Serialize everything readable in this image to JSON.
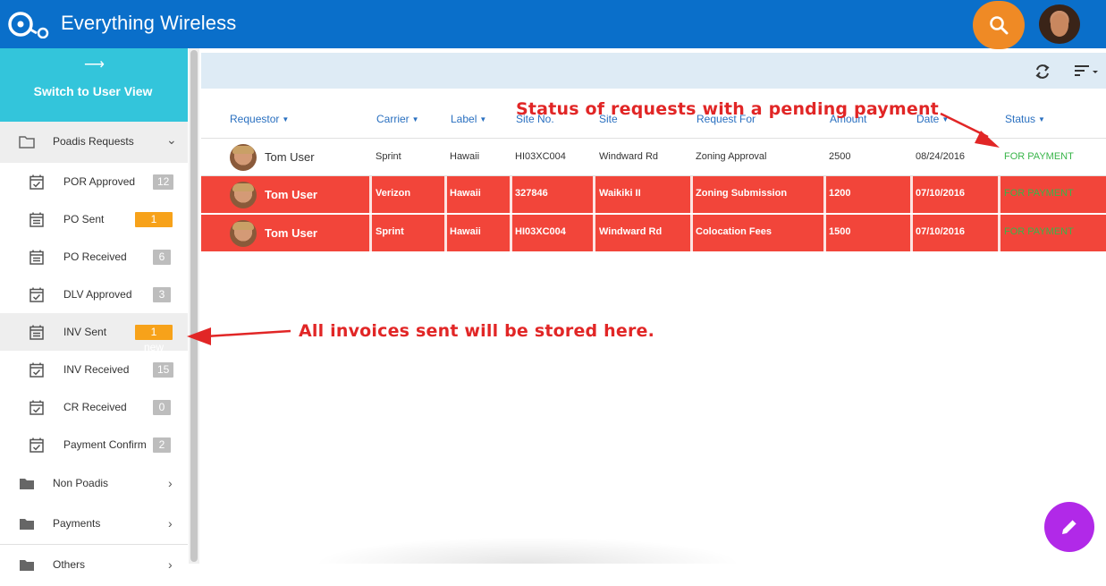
{
  "app": {
    "title": "Everything Wireless"
  },
  "sidebar": {
    "switch_label": "Switch to User View",
    "open_section": "Poadis Requests",
    "items": [
      {
        "label": "POR Approved",
        "badge": "12",
        "badge_type": "grey",
        "icon": "calendar-check-icon"
      },
      {
        "label": "PO Sent",
        "badge": "1 new",
        "badge_type": "orange",
        "icon": "calendar-list-icon"
      },
      {
        "label": "PO Received",
        "badge": "6",
        "badge_type": "grey",
        "icon": "calendar-list-icon"
      },
      {
        "label": "DLV Approved",
        "badge": "3",
        "badge_type": "grey",
        "icon": "calendar-check-icon"
      },
      {
        "label": "INV Sent",
        "badge": "1 new",
        "badge_type": "orange",
        "icon": "calendar-list-icon"
      },
      {
        "label": "INV Received",
        "badge": "15",
        "badge_type": "grey",
        "icon": "calendar-check-icon"
      },
      {
        "label": "CR Received",
        "badge": "0",
        "badge_type": "grey",
        "icon": "calendar-check-icon"
      },
      {
        "label": "Payment Confirm",
        "badge": "2",
        "badge_type": "grey",
        "icon": "calendar-check-icon"
      }
    ],
    "sections": [
      "Non Poadis",
      "Payments",
      "Others"
    ]
  },
  "table": {
    "headers": [
      "Requestor",
      "Carrier",
      "Label",
      "Site No.",
      "Site",
      "Request For",
      "Amount",
      "Date",
      "Status"
    ],
    "rows": [
      {
        "user": "Tom User",
        "carrier": "Sprint",
        "label": "Hawaii",
        "site_no": "HI03XC004",
        "site": "Windward Rd",
        "request_for": "Zoning Approval",
        "amount": "2500",
        "date": "08/24/2016",
        "status": "FOR PAYMENT"
      },
      {
        "user": "Tom User",
        "carrier": "Verizon",
        "label": "Hawaii",
        "site_no": "327846",
        "site": "Waikiki II",
        "request_for": "Zoning Submission",
        "amount": "1200",
        "date": "07/10/2016",
        "status": "FOR PAYMENT"
      },
      {
        "user": "Tom User",
        "carrier": "Sprint",
        "label": "Hawaii",
        "site_no": "HI03XC004",
        "site": "Windward Rd",
        "request_for": "Colocation Fees",
        "amount": "1500",
        "date": "07/10/2016",
        "status": "FOR PAYMENT"
      }
    ]
  },
  "annotations": {
    "status_note": "Status of requests with a pending payment",
    "invoice_note": "All invoices sent will be stored here."
  },
  "colors": {
    "appbar": "#0a6fca",
    "accent": "#33c5db",
    "highlight_row": "#f2453a",
    "status": "#39b54a",
    "fab": "#b129e8",
    "search": "#ef8a25"
  }
}
